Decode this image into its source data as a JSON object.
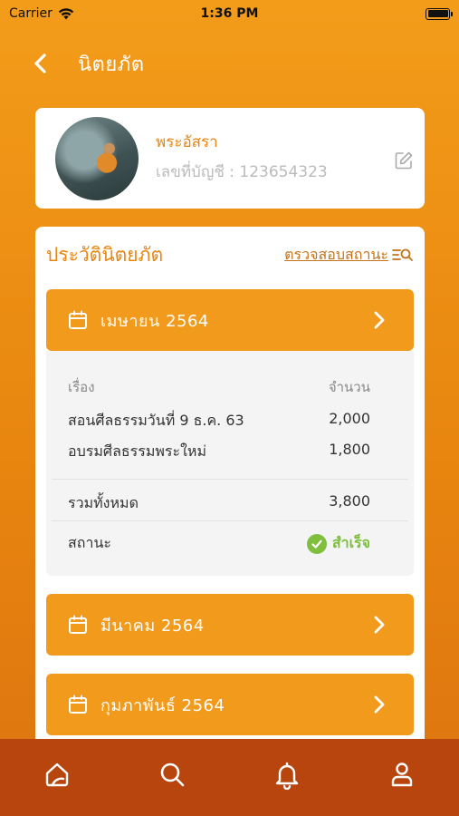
{
  "status_bar": {
    "carrier": "Carrier",
    "time": "1:36 PM"
  },
  "nav": {
    "title": "นิตยภัต"
  },
  "profile": {
    "name": "พระอัสรา",
    "account": "เลขที่บัญชี : 123654323"
  },
  "history": {
    "title": "ประวัตินิตยภัต",
    "check_status_label": "ตรวจสอบสถานะ",
    "months": [
      {
        "label": "เมษายน 2564"
      },
      {
        "label": "มีนาคม 2564"
      },
      {
        "label": "กุมภาพันธ์ 2564"
      }
    ],
    "detail": {
      "col_subject": "เรื่อง",
      "col_amount": "จำนวน",
      "rows": [
        {
          "subject": "สอนศีลธรรมวันที่ 9 ธ.ค. 63",
          "amount": "2,000"
        },
        {
          "subject": "อบรมศีลธรรมพระใหม่",
          "amount": "1,800"
        }
      ],
      "total_label": "รวมทั้งหมด",
      "total_amount": "3,800",
      "status_label": "สถานะ",
      "status_value": "สำเร็จ"
    }
  },
  "tabbar": {
    "icons": [
      "home-icon",
      "search-icon",
      "bell-icon",
      "user-icon"
    ]
  },
  "colors": {
    "accent": "#f19a1c",
    "tabbar": "#b8440e",
    "success": "#7fbf3d"
  }
}
